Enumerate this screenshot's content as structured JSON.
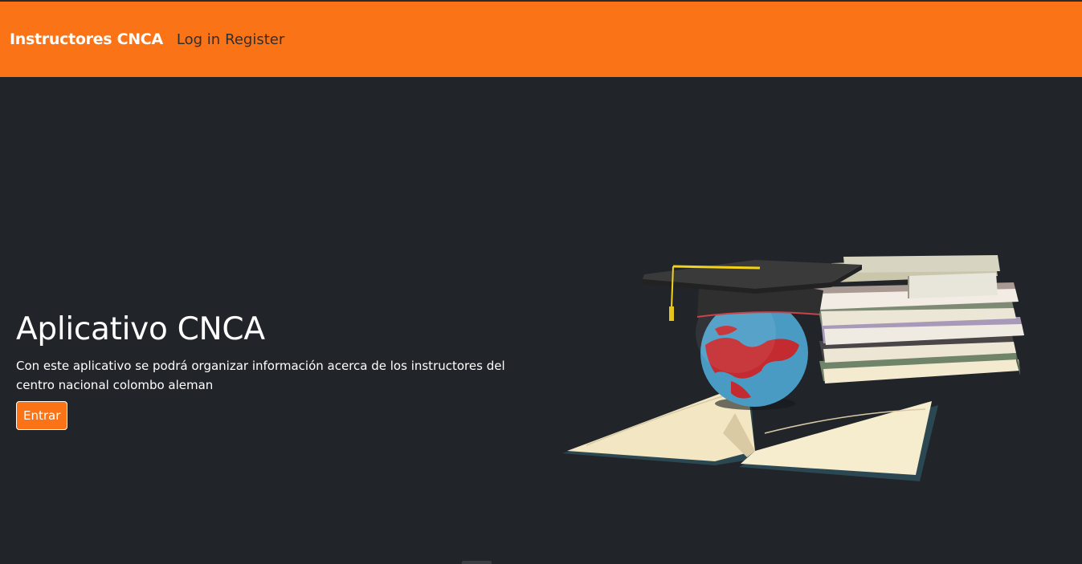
{
  "navbar": {
    "brand": "Instructores CNCA",
    "login": "Log in",
    "register": "Register"
  },
  "hero": {
    "title": "Aplicativo CNCA",
    "description": "Con este aplicativo se podrá organizar información acerca de los instructores del centro nacional colombo aleman",
    "button": "Entrar"
  },
  "colors": {
    "navbar": "#fa7316",
    "background": "#212429",
    "button": "#fa7316"
  },
  "icons": {
    "illustration": "graduation-globe-books-illustration"
  }
}
